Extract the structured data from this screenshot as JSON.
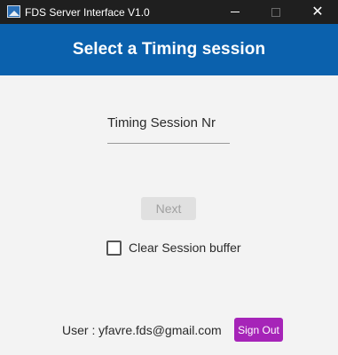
{
  "window": {
    "title": "FDS Server Interface V1.0",
    "close_glyph": "✕",
    "icons": [
      "app-icon",
      "minimize-icon",
      "maximize-icon",
      "close-icon"
    ]
  },
  "header": {
    "title": "Select a Timing session",
    "background": "#0b61ad"
  },
  "session": {
    "placeholder": "Timing Session Nr",
    "value": ""
  },
  "next_button": {
    "label": "Next",
    "enabled": false
  },
  "clear_buffer": {
    "label": "Clear Session buffer",
    "checked": false
  },
  "footer": {
    "user_label": "User :",
    "user_email": "yfavre.fds@gmail.com",
    "signout_label": "Sign Out",
    "signout_color": "#a624b8"
  }
}
